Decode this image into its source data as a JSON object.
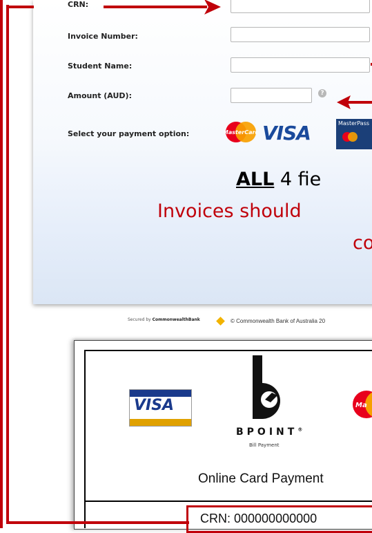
{
  "form": {
    "fields": [
      {
        "label": "CRN:",
        "value": ""
      },
      {
        "label": "Invoice Number:",
        "value": ""
      },
      {
        "label": "Student Name:",
        "value": ""
      },
      {
        "label": "Amount (AUD):",
        "value": ""
      }
    ],
    "payment_label": "Select your payment option:",
    "payment_options": [
      "MasterCard",
      "VISA",
      "MasterPass"
    ],
    "help_icon": "?"
  },
  "callout": {
    "line1_bold": "ALL",
    "line1_rest": " 4 fie",
    "line2": "Invoices should",
    "line3": "co"
  },
  "footer": {
    "secured_prefix": "Secured by ",
    "secured_brand": "CommonwealthBank",
    "copyright": "© Commonwealth Bank of Australia 20"
  },
  "document": {
    "visa": "VISA",
    "brand": "BPOINT",
    "brand_mark": "®",
    "subtitle": "Bill Payment",
    "mastercard_partial": "Ma",
    "title": "Online Card Payment",
    "crn_line": "CRN:  000000000000"
  },
  "colors": {
    "arrow_red": "#c0000a",
    "callout_text_red": "#c0000a",
    "visa_blue": "#1a4a9c",
    "card_gradient_end": "#dbe6f5"
  }
}
